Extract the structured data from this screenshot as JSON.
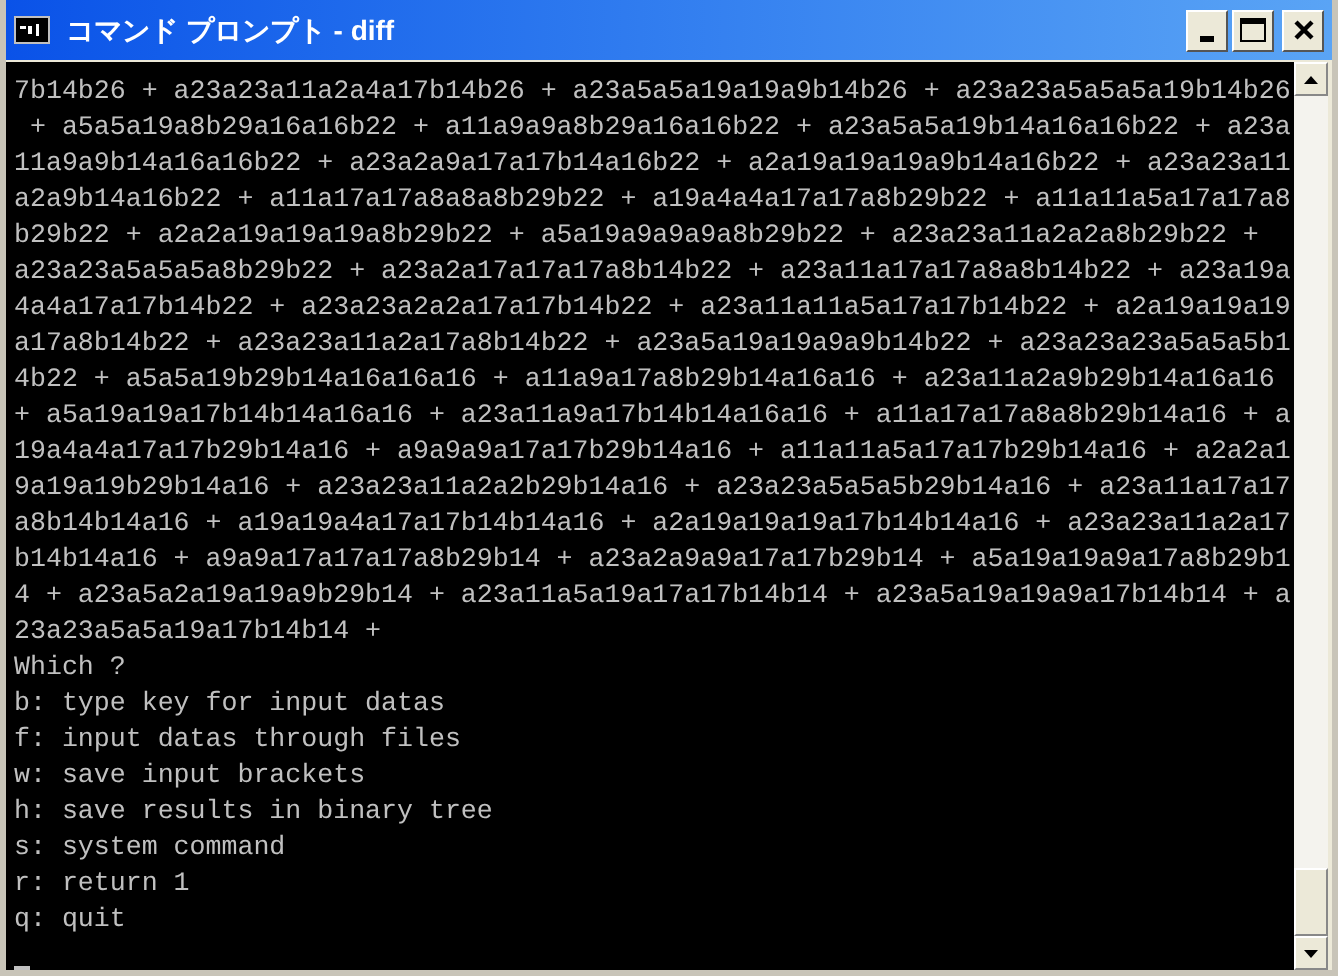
{
  "window": {
    "title": "コマンド プロンプト - diff"
  },
  "console": {
    "lines": [
      "7b14b26 + a23a23a11a2a4a17b14b26 + a23a5a5a19a19a9b14b26 + a23a23a5a5a5a19b14b26",
      " + a5a5a19a8b29a16a16b22 + a11a9a9a8b29a16a16b22 + a23a5a5a19b14a16a16b22 + a23a",
      "11a9a9b14a16a16b22 + a23a2a9a17a17b14a16b22 + a2a19a19a19a9b14a16b22 + a23a23a11",
      "a2a9b14a16b22 + a11a17a17a8a8a8b29b22 + a19a4a4a17a17a8b29b22 + a11a11a5a17a17a8",
      "b29b22 + a2a2a19a19a19a8b29b22 + a5a19a9a9a9a8b29b22 + a23a23a11a2a2a8b29b22 +",
      "a23a23a5a5a5a8b29b22 + a23a2a17a17a17a8b14b22 + a23a11a17a17a8a8b14b22 + a23a19a",
      "4a4a17a17b14b22 + a23a23a2a2a17a17b14b22 + a23a11a11a5a17a17b14b22 + a2a19a19a19",
      "a17a8b14b22 + a23a23a11a2a17a8b14b22 + a23a5a19a19a9a9b14b22 + a23a23a23a5a5a5b1",
      "4b22 + a5a5a19b29b14a16a16a16 + a11a9a17a8b29b14a16a16 + a23a11a2a9b29b14a16a16",
      "+ a5a19a19a17b14b14a16a16 + a23a11a9a17b14b14a16a16 + a11a17a17a8a8b29b14a16 + a",
      "19a4a4a17a17b29b14a16 + a9a9a9a17a17b29b14a16 + a11a11a5a17a17b29b14a16 + a2a2a1",
      "9a19a19b29b14a16 + a23a23a11a2a2b29b14a16 + a23a23a5a5a5b29b14a16 + a23a11a17a17",
      "a8b14b14a16 + a19a19a4a17a17b14b14a16 + a2a19a19a19a17b14b14a16 + a23a23a11a2a17",
      "b14b14a16 + a9a9a17a17a17a8b29b14 + a23a2a9a9a17a17b29b14 + a5a19a19a9a17a8b29b1",
      "4 + a23a5a2a19a19a9b29b14 + a23a11a5a19a17a17b14b14 + a23a5a19a19a9a17b14b14 + a",
      "23a23a5a5a19a17b14b14 +",
      "Which ?",
      "b: type key for input datas",
      "f: input datas through files",
      "w: save input brackets",
      "h: save results in binary tree",
      "s: system command",
      "r: return 1",
      "q: quit"
    ]
  }
}
